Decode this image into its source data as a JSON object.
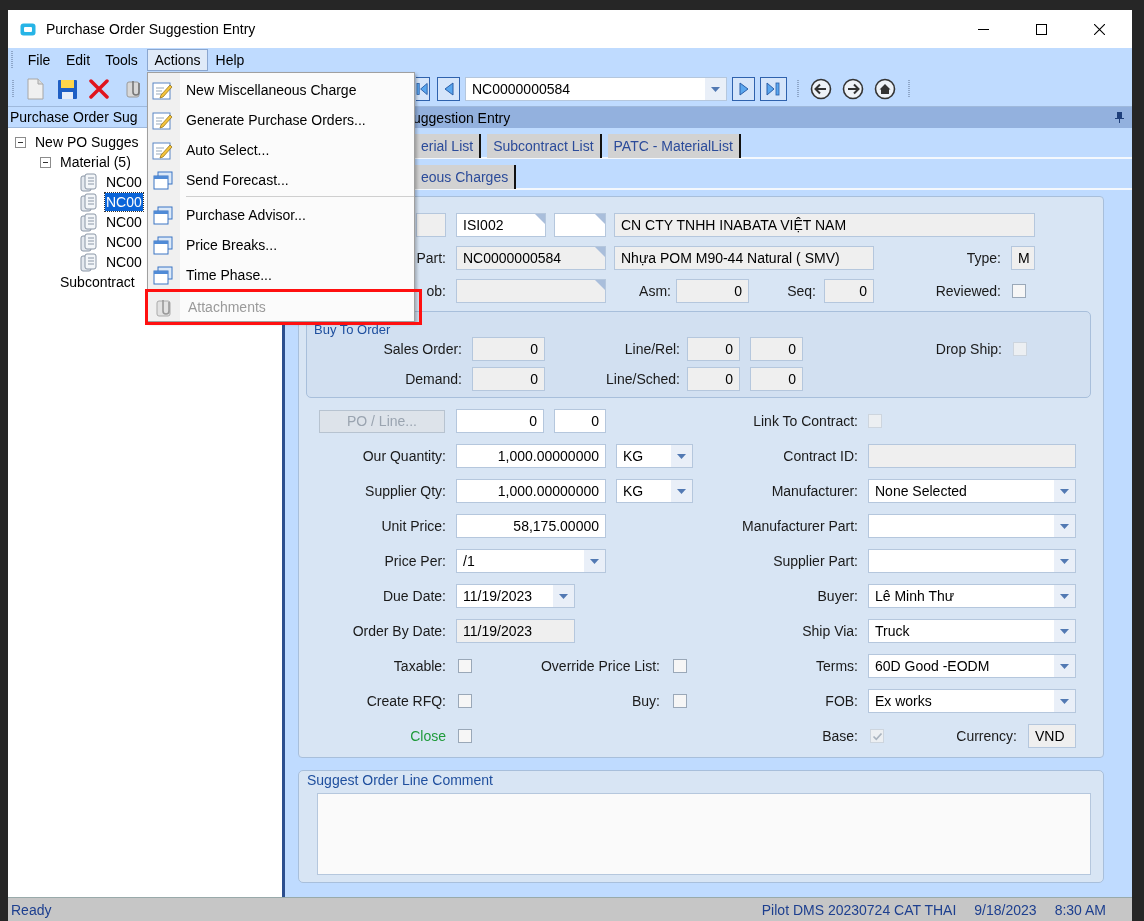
{
  "window": {
    "title": "Purchase Order Suggestion Entry"
  },
  "menu_bar": [
    {
      "label": "File",
      "selected": false
    },
    {
      "label": "Edit",
      "selected": false
    },
    {
      "label": "Tools",
      "selected": false
    },
    {
      "label": "Actions",
      "selected": true
    },
    {
      "label": "Help",
      "selected": false
    }
  ],
  "actions_menu": {
    "groups": [
      {
        "items": [
          {
            "label": "New Miscellaneous Charge",
            "kind": "edit",
            "disabled": false,
            "outlined": false
          },
          {
            "label": "Generate Purchase Orders...",
            "kind": "edit",
            "disabled": false,
            "outlined": false
          },
          {
            "label": "Auto Select...",
            "kind": "edit",
            "disabled": false,
            "outlined": false
          },
          {
            "label": "Send Forecast...",
            "kind": "window",
            "disabled": false,
            "outlined": false
          }
        ]
      },
      {
        "items": [
          {
            "label": "Purchase Advisor...",
            "kind": "window",
            "disabled": false,
            "outlined": false
          },
          {
            "label": "Price Breaks...",
            "kind": "window",
            "disabled": false,
            "outlined": false
          },
          {
            "label": "Time Phase...",
            "kind": "window",
            "disabled": false,
            "outlined": false
          },
          {
            "label": "Attachments",
            "kind": "attach",
            "disabled": true,
            "outlined": true
          }
        ]
      }
    ]
  },
  "toolbar": {
    "record": "NC0000000584"
  },
  "tree": {
    "title": "Purchase Order Sug",
    "nodes": [
      {
        "label": "New PO Sugges",
        "kind": "folder",
        "expanded": true,
        "selected": false,
        "children": [
          {
            "label": "Material (5)",
            "kind": "folder",
            "expanded": true,
            "selected": false,
            "children": [
              {
                "label": "NC00",
                "kind": "item",
                "selected": false
              },
              {
                "label": "NC00",
                "kind": "item",
                "selected": true
              },
              {
                "label": "NC00",
                "kind": "item",
                "selected": false
              },
              {
                "label": "NC00",
                "kind": "item",
                "selected": false
              },
              {
                "label": "NC00",
                "kind": "item",
                "selected": false
              }
            ]
          },
          {
            "label": "Subcontract",
            "kind": "folder",
            "selected": false
          }
        ]
      }
    ]
  },
  "panel": {
    "title": "uggestion Entry"
  },
  "tab_rows": [
    {
      "tabs": [
        {
          "label": "erial List",
          "selected": false
        },
        {
          "label": "Subcontract List",
          "selected": false
        },
        {
          "label": "PATC - MaterialList",
          "selected": false
        }
      ]
    },
    {
      "tabs": [
        {
          "label": "eous Charges",
          "selected": false
        }
      ]
    }
  ],
  "header": {
    "supplier": [
      {
        "disabled": true
      },
      {
        "value": "ISI002",
        "disabled": false
      },
      {
        "disabled": false
      },
      {
        "value": "CN CTY TNHH INABATA VIỆT NAM",
        "disabled": true
      }
    ],
    "part_label": "Part:",
    "part": {
      "value": "NC0000000584",
      "disabled": true
    },
    "part_description": {
      "value": "Nhựa POM M90-44 Natural ( SMV)",
      "disabled": true
    },
    "type_label": "Type:",
    "type": {
      "value": "M",
      "disabled": true
    },
    "job_label": "ob:",
    "job": {
      "disabled": true
    },
    "asm_label": "Asm:",
    "asm": {
      "value": "0",
      "disabled": true
    },
    "seq_label": "Seq:",
    "seq": {
      "value": "0",
      "disabled": true
    },
    "reviewed_label": "Reviewed:",
    "reviewed": {
      "checked": false,
      "disabled": false
    }
  },
  "buy_to_order": {
    "title": "Buy To Order",
    "sales_order_label": "Sales Order:",
    "sales_order": {
      "value": "0",
      "disabled": true
    },
    "line_rel_label": "Line/Rel:",
    "line_rel": [
      {
        "value": "0",
        "disabled": true
      },
      {
        "value": "0",
        "disabled": true
      }
    ],
    "drop_ship_label": "Drop Ship:",
    "drop_ship": {
      "checked": false,
      "disabled": true
    },
    "demand_label": "Demand:",
    "demand": {
      "value": "0",
      "disabled": true
    },
    "line_sched_label": "Line/Sched:",
    "line_sched": [
      {
        "value": "0",
        "disabled": true
      },
      {
        "value": "0",
        "disabled": true
      }
    ]
  },
  "details": {
    "po_line_button": {
      "label": "PO / Line...",
      "disabled": true
    },
    "po_line": [
      {
        "value": "0",
        "disabled": false
      },
      {
        "value": "0",
        "disabled": false
      }
    ],
    "link_to_contract_label": "Link To Contract:",
    "link_to_contract": {
      "checked": false,
      "disabled": true
    },
    "our_quantity_label": "Our Quantity:",
    "our_quantity": {
      "value": "1,000.00000000",
      "disabled": false
    },
    "our_uom": {
      "value": "KG",
      "disabled": false
    },
    "contract_id_label": "Contract ID:",
    "contract_id": {
      "disabled": true
    },
    "supplier_qty_label": "Supplier Qty:",
    "supplier_qty": {
      "value": "1,000.00000000",
      "disabled": false
    },
    "supplier_uom": {
      "value": "KG",
      "disabled": false
    },
    "manufacturer_label": "Manufacturer:",
    "manufacturer": {
      "value": "None Selected",
      "disabled": false
    },
    "unit_price_label": "Unit Price:",
    "unit_price": {
      "value": "58,175.00000",
      "disabled": false
    },
    "manufacturer_part_label": "Manufacturer Part:",
    "manufacturer_part": {
      "disabled": false
    },
    "price_per_label": "Price Per:",
    "price_per": {
      "value": "/1",
      "disabled": false
    },
    "supplier_part_label": "Supplier Part:",
    "supplier_part": {
      "disabled": false
    },
    "due_date_label": "Due Date:",
    "due_date": {
      "value": "11/19/2023",
      "disabled": false
    },
    "buyer_label": "Buyer:",
    "buyer": {
      "value": "Lê Minh Thư",
      "disabled": false
    },
    "order_by_date_label": "Order By Date:",
    "order_by_date": {
      "value": "11/19/2023",
      "disabled": true
    },
    "ship_via_label": "Ship Via:",
    "ship_via": {
      "value": "Truck",
      "disabled": false
    },
    "taxable_label": "Taxable:",
    "taxable": {
      "checked": false,
      "disabled": false
    },
    "override_price_list_label": "Override Price List:",
    "override_price_list": {
      "checked": false,
      "disabled": false
    },
    "terms_label": "Terms:",
    "terms": {
      "value": "60D Good -EODM",
      "disabled": false
    },
    "create_rfq_label": "Create RFQ:",
    "create_rfq": {
      "checked": false,
      "disabled": false
    },
    "buy_label": "Buy:",
    "buy": {
      "checked": false,
      "disabled": false
    },
    "fob_label": "FOB:",
    "fob": {
      "value": "Ex works",
      "disabled": false
    },
    "close_label": "Close",
    "close": {
      "checked": false,
      "disabled": false
    },
    "base_label": "Base:",
    "base": {
      "checked": true,
      "disabled": true
    },
    "currency_label": "Currency:",
    "currency": {
      "value": "VND",
      "disabled": true
    }
  },
  "comment": {
    "title": "Suggest Order Line Comment"
  },
  "status_bar": {
    "message": "Ready",
    "items": [
      "Pilot DMS 20230724 CAT THAI",
      "9/18/2023",
      "8:30 AM"
    ]
  }
}
